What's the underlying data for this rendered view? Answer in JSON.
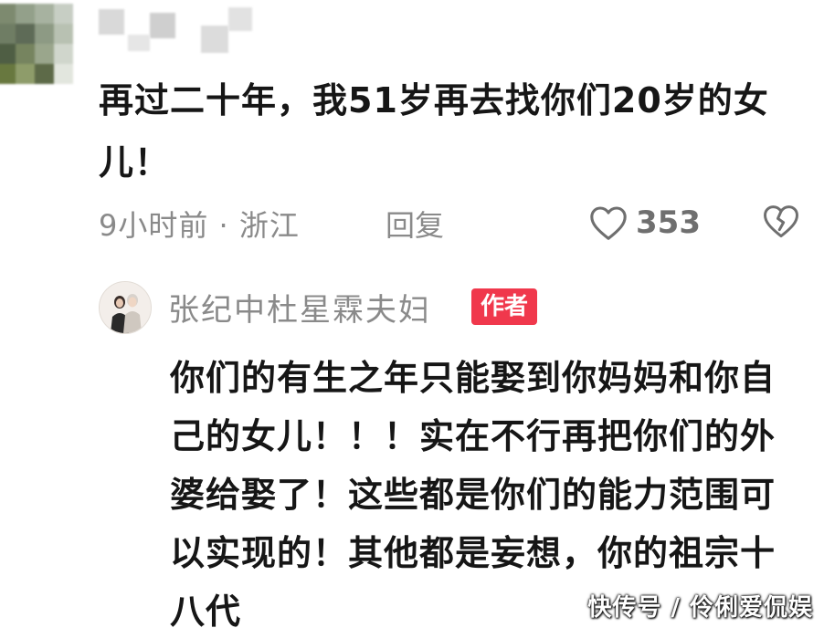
{
  "comment": {
    "text": "再过二十年，我51岁再去找你们20岁的女儿！",
    "meta": "9小时前 · 浙江",
    "reply_label": "回复",
    "like_count": "353",
    "like_icon": "heart-outline-icon",
    "dislike_icon": "broken-heart-icon"
  },
  "reply": {
    "author": "张纪中杜星霖夫妇",
    "badge": "作者",
    "text": "你们的有生之年只能娶到你妈妈和你自己的女儿！！！实在不行再把你们的外婆给娶了！这些都是你们的能力范围可以实现的！其他都是妄想，你的祖宗十八代"
  },
  "watermark": "快传号 / 伶俐爱侃娱",
  "colors": {
    "badge": "#f0384c",
    "meta_text": "#8a8a8a",
    "body_text": "#161616"
  }
}
